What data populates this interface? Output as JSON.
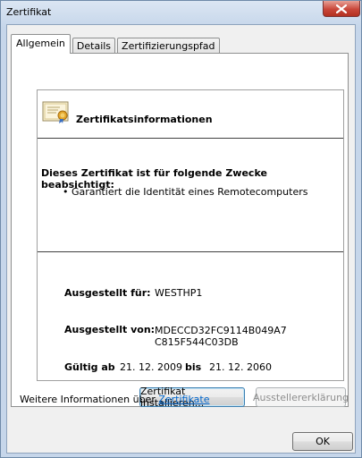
{
  "window": {
    "title": "Zertifikat"
  },
  "tabs": [
    {
      "label": "Allgemein",
      "active": true
    },
    {
      "label": "Details",
      "active": false
    },
    {
      "label": "Zertifizierungspfad",
      "active": false
    }
  ],
  "certificate": {
    "info_title": "Zertifikatsinformationen",
    "purpose_heading": "Dieses Zertifikat ist für folgende Zwecke beabsichtigt:",
    "purposes": [
      "• Garantiert die Identität eines Remotecomputers"
    ],
    "issued_to_label": "Ausgestellt für:",
    "issued_to_value": "WESTHP1",
    "issued_by_label": "Ausgestellt von:",
    "issued_by_value": "MDECCD32FC9114B049A7C815F544C03DB",
    "valid_from_label": "Gültig ab",
    "valid_from_value": "21. 12. 2009",
    "valid_to_label": "bis",
    "valid_to_value": "21. 12. 2060"
  },
  "buttons": {
    "install": "Zertifikat installieren...",
    "issuer_statement": "Ausstellererklärung",
    "ok": "OK"
  },
  "footer": {
    "prefix": "Weitere Informationen über",
    "link": "Zertifikate"
  },
  "icons": {
    "close": "close-icon",
    "certificate": "certificate-icon"
  }
}
